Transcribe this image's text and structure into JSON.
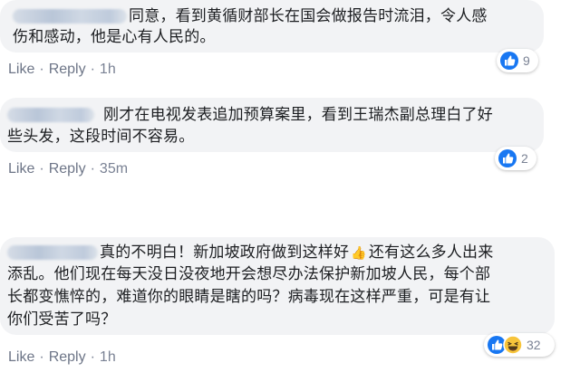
{
  "comments": [
    {
      "text_line1": "同意，看到黄循财部长在国会做报告时流泪，令人感",
      "text_line2": "伤和感动，他是心有人民的。",
      "like_label": "Like",
      "reply_label": "Reply",
      "separator": "·",
      "time": "1h",
      "reaction_count": "9",
      "reaction_icons": [
        "like-icon"
      ]
    },
    {
      "text_line1": "刚才在电视发表追加预算案里，看到王瑞杰副总理白了好",
      "text_line2": "些头发，这段时间不容易。",
      "like_label": "Like",
      "reply_label": "Reply",
      "separator": "·",
      "time": "35m",
      "reaction_count": "2",
      "reaction_icons": [
        "like-icon"
      ]
    },
    {
      "text_line1a": "真的不明白！新加坡政府做到这样好",
      "emoji_thumb": "👍",
      "text_line1b": "还有这么多人出来",
      "text_line2": "添乱。他们现在每天没日没夜地开会想尽办法保护新加坡人民，每个部",
      "text_line3": "长都变憔悴的，难道你的眼睛是瞎的吗？病毒现在这样严重，可是有让",
      "text_line4": "你们受苦了吗？",
      "like_label": "Like",
      "reply_label": "Reply",
      "separator": "·",
      "time": "1h",
      "reaction_count": "32",
      "reaction_icons": [
        "like-icon",
        "haha-icon"
      ]
    }
  ],
  "colors": {
    "bubble": "#f2f3f5",
    "text": "#1c1e21",
    "meta": "#7a8294",
    "like_blue": "#1877f2",
    "haha_yellow": "#f7c43b"
  }
}
